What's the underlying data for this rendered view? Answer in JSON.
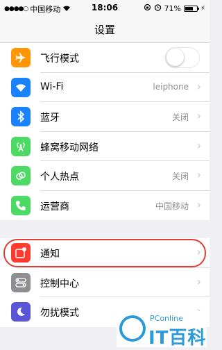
{
  "status_bar": {
    "carrier": "中国移动",
    "time": "18:06",
    "battery": "71%",
    "battery_level": 0.71
  },
  "nav": {
    "title": "设置"
  },
  "group1": [
    {
      "label": "飞行模式",
      "icon": "airplane-icon",
      "color": "#ff9500",
      "control": "toggle",
      "toggle_on": false
    },
    {
      "label": "Wi-Fi",
      "icon": "wifi-icon",
      "color": "#1a82fb",
      "value": "leiphone"
    },
    {
      "label": "蓝牙",
      "icon": "bluetooth-icon",
      "color": "#1a82fb",
      "value": "关闭"
    },
    {
      "label": "蜂窝移动网络",
      "icon": "cellular-icon",
      "color": "#4cd964",
      "value": ""
    },
    {
      "label": "个人热点",
      "icon": "hotspot-icon",
      "color": "#4cd964",
      "value": "关闭"
    },
    {
      "label": "运营商",
      "icon": "phone-icon",
      "color": "#4cd964",
      "value": "中国移动"
    }
  ],
  "group2": [
    {
      "label": "通知",
      "icon": "notifications-icon",
      "color": "#ff3b30"
    },
    {
      "label": "控制中心",
      "icon": "control-center-icon",
      "color": "#8e8e93"
    },
    {
      "label": "勿扰模式",
      "icon": "do-not-disturb-icon",
      "color": "#5856d6"
    }
  ],
  "watermark": {
    "brand": "PConline",
    "text": "IT百科"
  }
}
